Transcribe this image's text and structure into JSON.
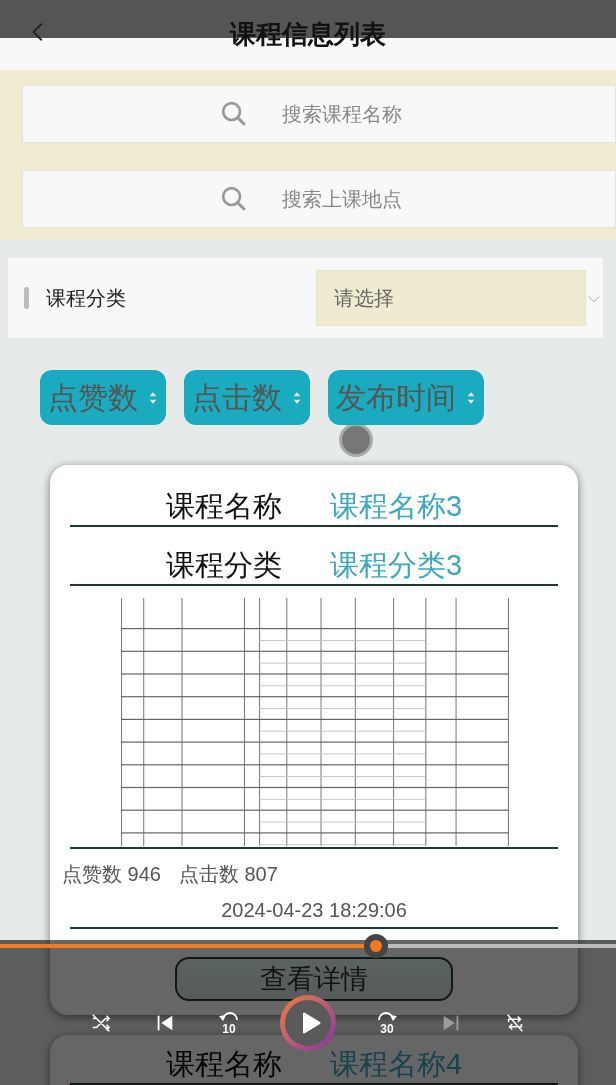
{
  "header": {
    "title": "课程信息列表"
  },
  "searches": [
    {
      "placeholder": "搜索课程名称"
    },
    {
      "placeholder": "搜索上课地点"
    }
  ],
  "category_filter": {
    "label": "课程分类",
    "placeholder": "请选择"
  },
  "sort_buttons": [
    {
      "label": "点赞数"
    },
    {
      "label": "点击数"
    },
    {
      "label": "发布时间"
    }
  ],
  "cards": [
    {
      "name_label": "课程名称",
      "name": "课程名称3",
      "category_label": "课程分类",
      "category": "课程分类3",
      "likes_label": "点赞数",
      "likes": "946",
      "clicks_label": "点击数",
      "clicks": "807",
      "date": "2024-04-23 18:29:06",
      "button": "查看详情"
    },
    {
      "name_label": "课程名称",
      "name": "课程名称4"
    }
  ],
  "player": {
    "progress": {
      "level": 0.61
    },
    "controls": [
      {
        "kind": "shuffle",
        "disabled": false
      },
      {
        "kind": "previous",
        "disabled": false
      },
      {
        "kind": "rewind",
        "label": "10",
        "disabled": false
      },
      {
        "kind": "play",
        "disabled": false
      },
      {
        "kind": "forward",
        "label": "30",
        "disabled": false
      },
      {
        "kind": "next",
        "disabled": true
      },
      {
        "kind": "repeat",
        "disabled": false
      }
    ]
  }
}
